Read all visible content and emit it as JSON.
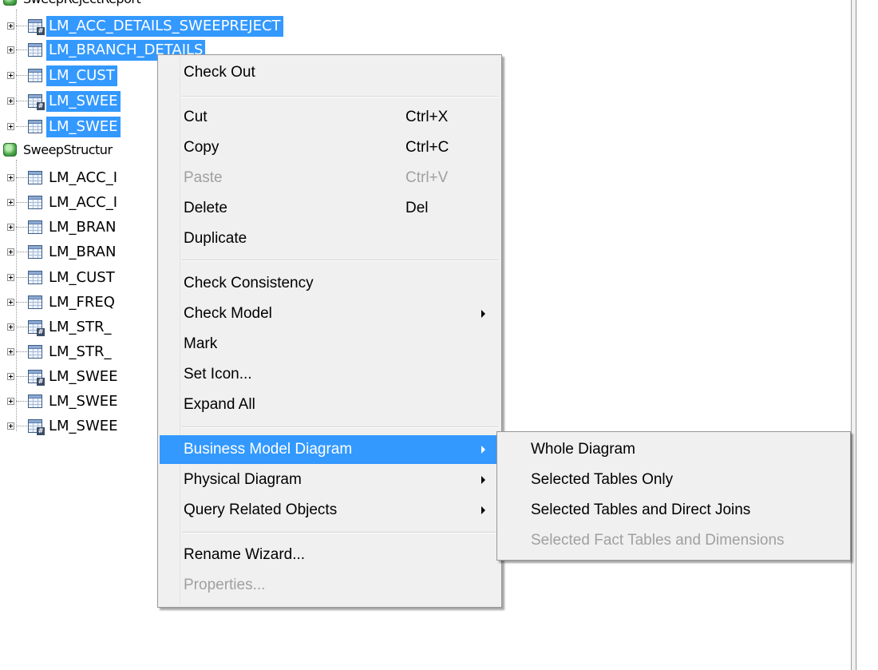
{
  "tree": {
    "top_group": {
      "label": "SweepRejectReport"
    },
    "top_items": [
      {
        "label": "LM_ACC_DETAILS_SWEEPREJECT",
        "icon": "table-group-icon"
      },
      {
        "label": "LM_BRANCH_DETAILS",
        "icon": "table-icon"
      },
      {
        "label": "LM_CUST",
        "icon": "table-icon"
      },
      {
        "label": "LM_SWEE",
        "icon": "table-group-icon"
      },
      {
        "label": "LM_SWEE",
        "icon": "table-icon"
      }
    ],
    "second_group": {
      "label": "SweepStructur"
    },
    "second_items": [
      {
        "label": "LM_ACC_I",
        "icon": "table-icon"
      },
      {
        "label": "LM_ACC_I",
        "icon": "table-icon"
      },
      {
        "label": "LM_BRAN",
        "icon": "table-icon"
      },
      {
        "label": "LM_BRAN",
        "icon": "table-icon"
      },
      {
        "label": "LM_CUST",
        "icon": "table-icon"
      },
      {
        "label": "LM_FREQ",
        "icon": "table-icon"
      },
      {
        "label": "LM_STR_",
        "icon": "table-group-icon"
      },
      {
        "label": "LM_STR_",
        "icon": "table-icon"
      },
      {
        "label": "LM_SWEE",
        "icon": "table-group-icon"
      },
      {
        "label": "LM_SWEE",
        "icon": "table-icon"
      },
      {
        "label": "LM_SWEE",
        "icon": "table-group-icon"
      }
    ]
  },
  "context_menu": {
    "items": [
      {
        "label": "Check Out"
      },
      {
        "label": "Cut",
        "shortcut": "Ctrl+X"
      },
      {
        "label": "Copy",
        "shortcut": "Ctrl+C"
      },
      {
        "label": "Paste",
        "shortcut": "Ctrl+V",
        "disabled": true
      },
      {
        "label": "Delete",
        "shortcut": "Del"
      },
      {
        "label": "Duplicate"
      },
      {
        "label": "Check Consistency"
      },
      {
        "label": "Check Model",
        "submenu": true
      },
      {
        "label": "Mark"
      },
      {
        "label": "Set Icon..."
      },
      {
        "label": "Expand All"
      },
      {
        "label": "Business Model Diagram",
        "submenu": true,
        "highlighted": true
      },
      {
        "label": "Physical Diagram",
        "submenu": true
      },
      {
        "label": "Query Related Objects",
        "submenu": true
      },
      {
        "label": "Rename Wizard..."
      },
      {
        "label": "Properties...",
        "disabled": true
      }
    ]
  },
  "submenu": {
    "items": [
      {
        "label": "Whole Diagram"
      },
      {
        "label": "Selected Tables Only"
      },
      {
        "label": "Selected Tables and Direct Joins"
      },
      {
        "label": "Selected Fact Tables and Dimensions",
        "disabled": true
      }
    ]
  },
  "colors": {
    "selection": "#3399ff",
    "menu_background": "#f0f0f0",
    "disabled_text": "#a0a0a0"
  }
}
